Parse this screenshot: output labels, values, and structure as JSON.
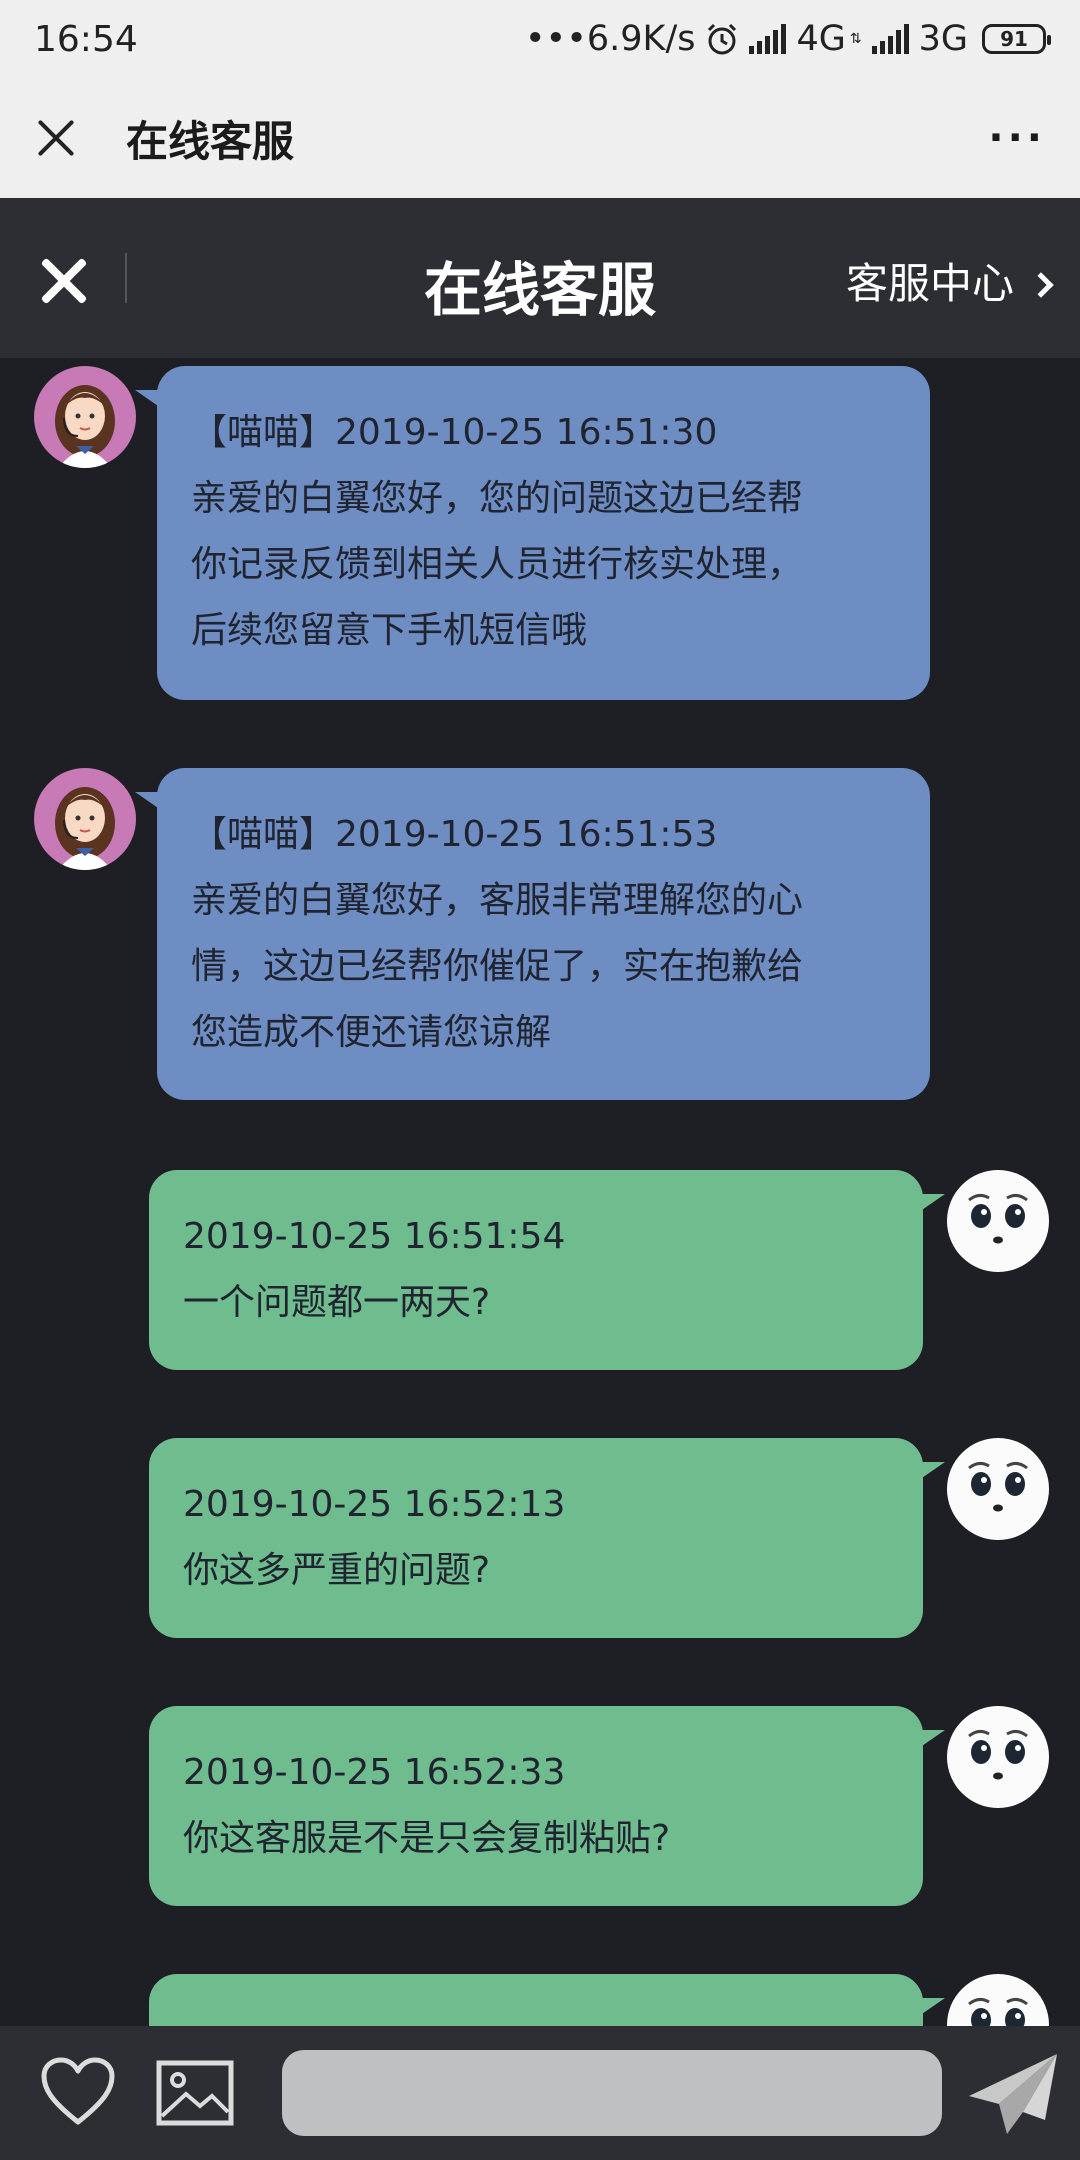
{
  "status_bar": {
    "time": "16:54",
    "speed": "•••6.9K/s",
    "network1": "4G",
    "network2": "3G",
    "battery": "91"
  },
  "browser_header": {
    "title": "在线客服",
    "more": "···"
  },
  "app_header": {
    "title": "在线客服",
    "service_center": "客服中心"
  },
  "messages": [
    {
      "sender": "agent",
      "lines": [
        "【喵喵】2019-10-25 16:51:30",
        "亲爱的白翼您好，您的问题这边已经帮",
        "你记录反馈到相关人员进行核实处理，",
        "后续您留意下手机短信哦"
      ]
    },
    {
      "sender": "agent",
      "lines": [
        "【喵喵】2019-10-25 16:51:53",
        "亲爱的白翼您好，客服非常理解您的心",
        "情，这边已经帮你催促了，实在抱歉给",
        "您造成不便还请您谅解"
      ]
    },
    {
      "sender": "user",
      "lines": [
        "2019-10-25 16:51:54",
        "一个问题都一两天?"
      ]
    },
    {
      "sender": "user",
      "lines": [
        "2019-10-25 16:52:13",
        "你这多严重的问题?"
      ]
    },
    {
      "sender": "user",
      "lines": [
        "2019-10-25 16:52:33",
        "你这客服是不是只会复制粘贴?"
      ]
    },
    {
      "sender": "user",
      "lines": []
    }
  ],
  "bottom_bar": {
    "input_placeholder": "",
    "icons": [
      "heart-icon",
      "image-icon",
      "send-icon"
    ]
  },
  "colors": {
    "agent_bubble": "#6e8dc3",
    "user_bubble": "#6fbc8f",
    "chat_bg": "#1e1f24",
    "header_bg": "#2c2e33"
  }
}
